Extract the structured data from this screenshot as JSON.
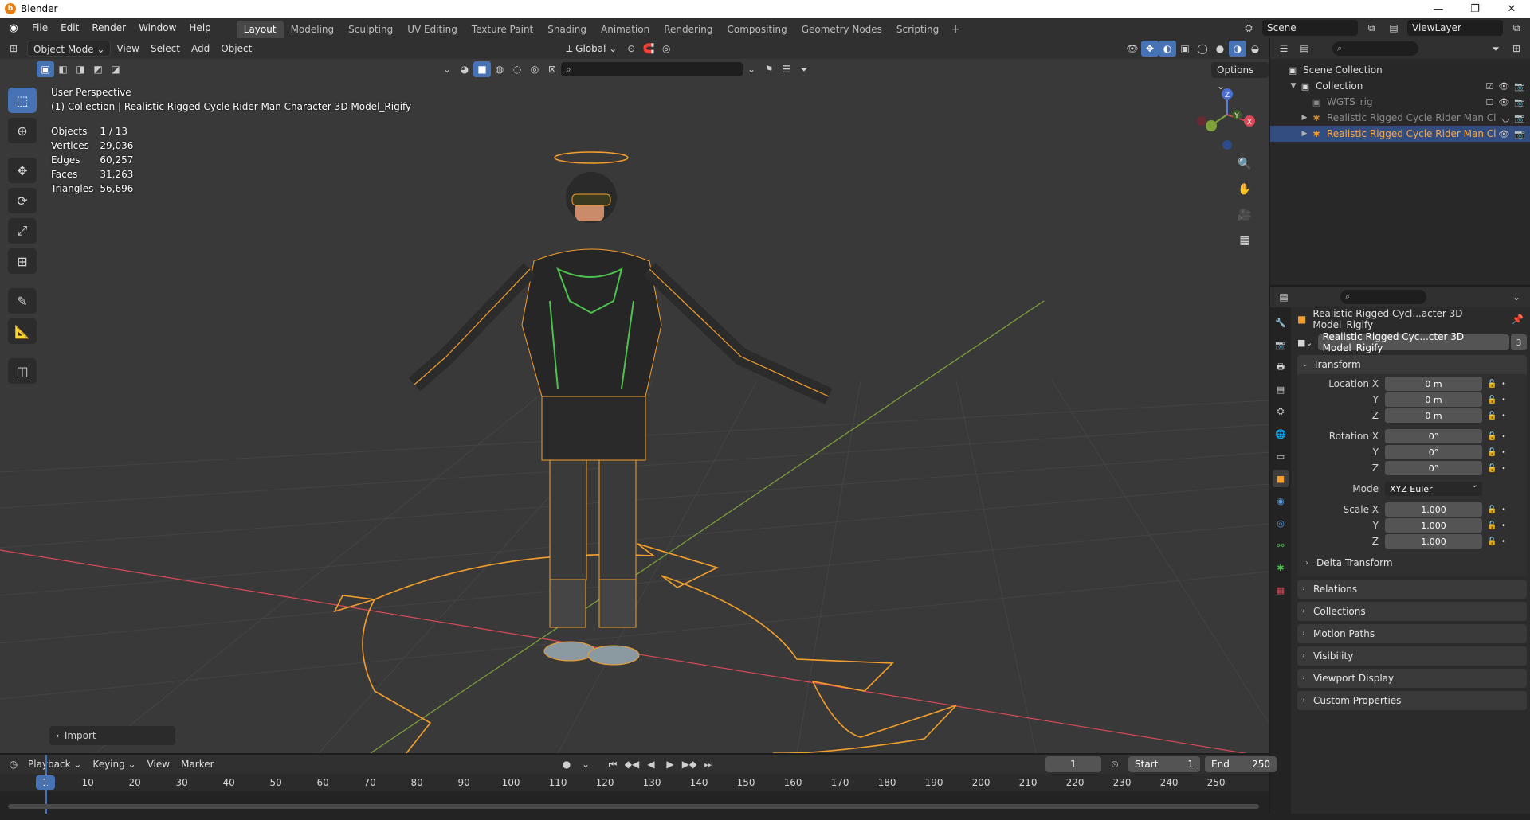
{
  "window": {
    "title": "Blender",
    "controls": [
      "—",
      "❐",
      "✕"
    ]
  },
  "topbar": {
    "menus": [
      "File",
      "Edit",
      "Render",
      "Window",
      "Help"
    ],
    "workspaces": [
      "Layout",
      "Modeling",
      "Sculpting",
      "UV Editing",
      "Texture Paint",
      "Shading",
      "Animation",
      "Rendering",
      "Compositing",
      "Geometry Nodes",
      "Scripting"
    ],
    "active_workspace": "Layout",
    "scene": "Scene",
    "view_layer": "ViewLayer"
  },
  "viewport": {
    "mode": "Object Mode",
    "menus": [
      "View",
      "Select",
      "Add",
      "Object"
    ],
    "orientation": "Global",
    "options_label": "Options",
    "perspective": "User Perspective",
    "active_info": "(1) Collection | Realistic Rigged Cycle Rider Man Character 3D Model_Rigify",
    "stats": [
      {
        "label": "Objects",
        "value": "1 / 13"
      },
      {
        "label": "Vertices",
        "value": "29,036"
      },
      {
        "label": "Edges",
        "value": "60,257"
      },
      {
        "label": "Faces",
        "value": "31,263"
      },
      {
        "label": "Triangles",
        "value": "56,696"
      }
    ],
    "last_operator": "Import",
    "gizmo_axes": [
      "X",
      "Y",
      "Z"
    ],
    "colors": {
      "background": "#393939",
      "grid": "#444444",
      "x_axis": "#d94a58",
      "y_axis": "#7fa33a",
      "selection": "#f59f2b"
    }
  },
  "outliner": {
    "root": "Scene Collection",
    "items": [
      {
        "name": "Collection",
        "level": 1
      },
      {
        "name": "WGTS_rig",
        "level": 2
      },
      {
        "name": "Realistic Rigged Cycle Rider Man Cl",
        "level": 2
      },
      {
        "name": "Realistic Rigged Cycle Rider Man Cl",
        "level": 2
      }
    ]
  },
  "properties": {
    "object_name": "Realistic Rigged Cycl...acter 3D Model_Rigify",
    "data_name": "Realistic Rigged Cyc...cter 3D Model_Rigify",
    "data_users": "3",
    "transform": {
      "title": "Transform",
      "location_label": "Location X",
      "rotation_label": "Rotation X",
      "scale_label": "Scale X",
      "y_label": "Y",
      "z_label": "Z",
      "mode_label": "Mode",
      "location": [
        "0 m",
        "0 m",
        "0 m"
      ],
      "rotation": [
        "0°",
        "0°",
        "0°"
      ],
      "mode": "XYZ Euler",
      "scale": [
        "1.000",
        "1.000",
        "1.000"
      ]
    },
    "delta_transform": "Delta Transform",
    "panels": [
      "Relations",
      "Collections",
      "Motion Paths",
      "Visibility",
      "Viewport Display",
      "Custom Properties"
    ]
  },
  "timeline": {
    "menus": [
      "Playback",
      "Keying",
      "View",
      "Marker"
    ],
    "current_frame": "1",
    "start_label": "Start",
    "start": "1",
    "end_label": "End",
    "end": "250",
    "ticks": [
      "10",
      "20",
      "30",
      "40",
      "50",
      "60",
      "70",
      "80",
      "90",
      "100",
      "110",
      "120",
      "130",
      "140",
      "150",
      "160",
      "170",
      "180",
      "190",
      "200",
      "210",
      "220",
      "230",
      "240",
      "250"
    ]
  }
}
